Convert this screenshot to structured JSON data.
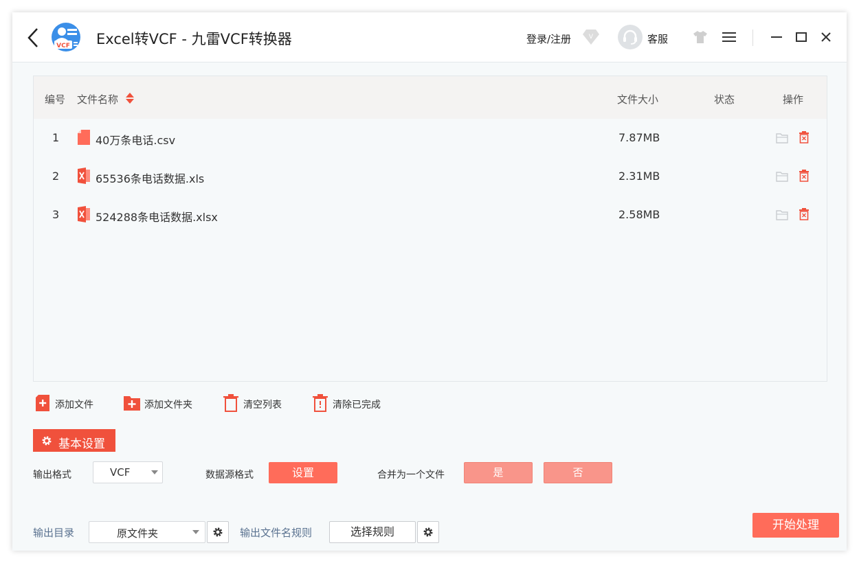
{
  "window": {
    "title": "Excel转VCF - 九雷VCF转换器",
    "logo_text": "VCF",
    "login_label": "登录/注册",
    "vip_letter": "V",
    "support_label": "客服"
  },
  "table": {
    "headers": {
      "index": "编号",
      "name": "文件名称",
      "size": "文件大小",
      "status": "状态",
      "ops": "操作"
    },
    "rows": [
      {
        "index": "1",
        "name": "40万条电话.csv",
        "size": "7.87MB",
        "status": "",
        "type": "csv-file-icon"
      },
      {
        "index": "2",
        "name": "65536条电话数据.xls",
        "size": "2.31MB",
        "status": "",
        "type": "excel-file-icon"
      },
      {
        "index": "3",
        "name": "524288条电话数据.xlsx",
        "size": "2.58MB",
        "status": "",
        "type": "excel-file-icon"
      }
    ]
  },
  "actions": {
    "add_file": "添加文件",
    "add_folder": "添加文件夹",
    "clear_list": "清空列表",
    "clear_done": "清除已完成"
  },
  "settings": {
    "tab_label": "基本设置",
    "output_format_label": "输出格式",
    "output_format_value": "VCF",
    "source_format_label": "数据源格式",
    "source_format_button": "设置",
    "merge_label": "合并为一个文件",
    "merge_yes": "是",
    "merge_no": "否",
    "output_dir_label": "输出目录",
    "output_dir_value": "原文件夹",
    "filename_rule_label": "输出文件名规则",
    "filename_rule_button": "选择规则",
    "start_button": "开始处理"
  },
  "colors": {
    "accent": "#f0513c",
    "button": "#ff6c5a",
    "button_soft": "#f9958a",
    "label_blue": "#5a7290"
  }
}
